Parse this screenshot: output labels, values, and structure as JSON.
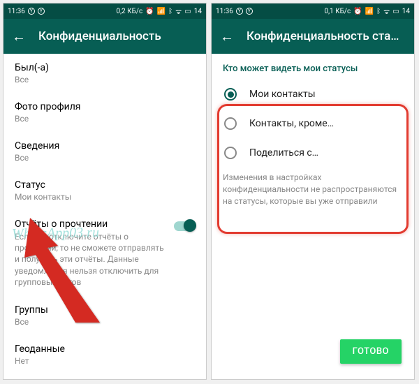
{
  "status": {
    "time": "11:36",
    "net_label": "0,2 КБ/с",
    "net_label2": "0,1 КБ/с",
    "battery": "14"
  },
  "left": {
    "title": "Конфиденциальность",
    "items": {
      "last_seen": {
        "title": "Был(-а)",
        "sub": "Все"
      },
      "photo": {
        "title": "Фото профиля",
        "sub": "Все"
      },
      "about": {
        "title": "Сведения",
        "sub": "Все"
      },
      "status": {
        "title": "Статус",
        "sub": "Мои контакты"
      },
      "read": {
        "title": "Отчёты о прочтении",
        "desc": "Если вы отключите отчёты о прочтении, то не сможете отправлять и получать эти отчёты. Данные уведомления нельзя отключить для групповых чатов"
      },
      "groups": {
        "title": "Группы",
        "sub": "Все"
      },
      "geo": {
        "title": "Геоданные",
        "sub": "Нет"
      }
    },
    "watermark": "WhatsApp03.ru"
  },
  "right": {
    "title": "Конфиденциальность ста…",
    "section": "Кто может видеть мои статусы",
    "options": {
      "o1": "Мои контакты",
      "o2": "Контакты, кроме…",
      "o3": "Поделиться с…"
    },
    "disclaimer": "Изменения в настройках конфиденциальности не распространяются на статусы, которые вы уже отправили",
    "done": "ГОТОВО"
  }
}
